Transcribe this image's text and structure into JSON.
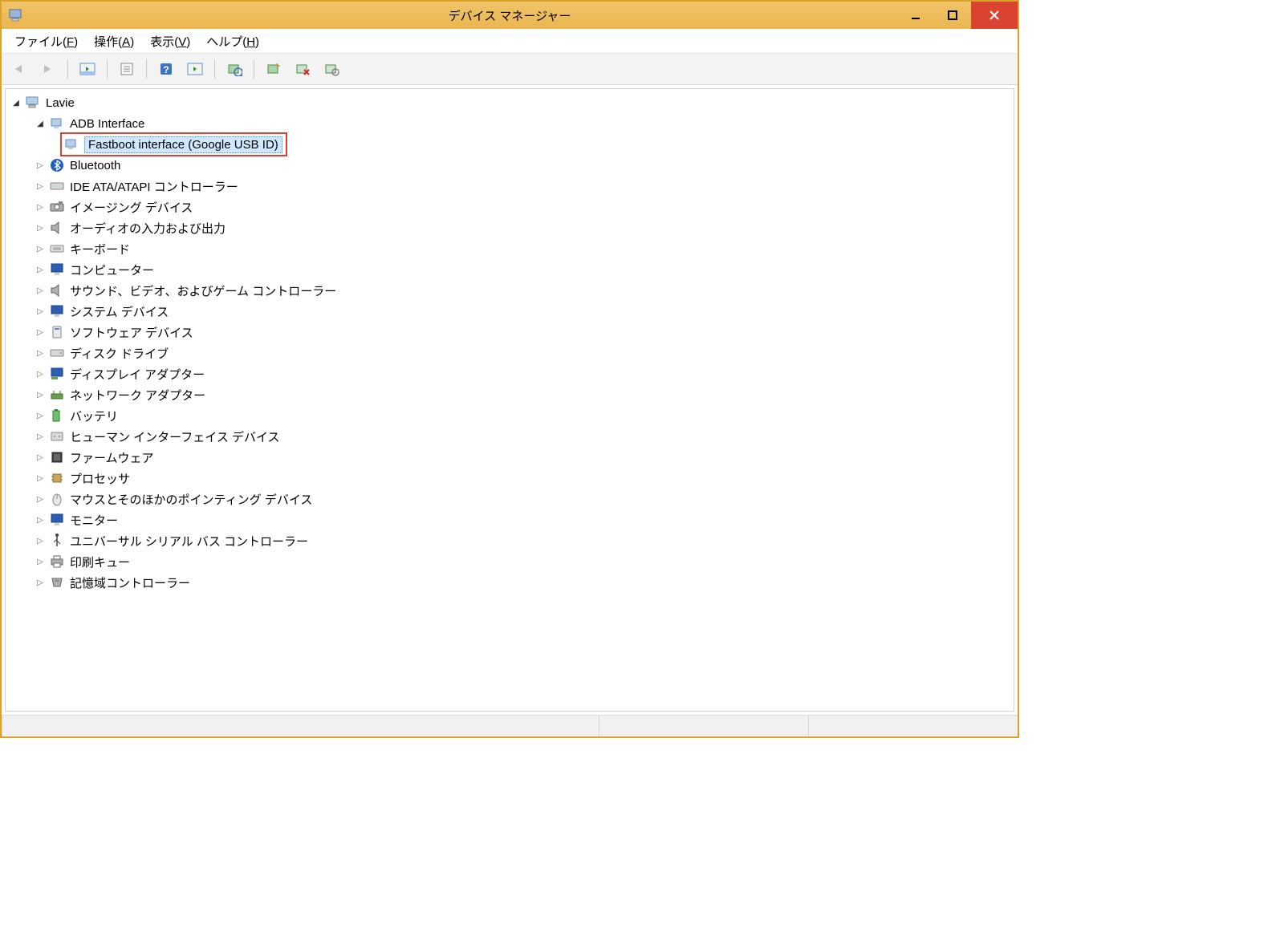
{
  "window": {
    "title": "デバイス マネージャー"
  },
  "menus": {
    "file": "ファイル(F)",
    "action": "操作(A)",
    "view": "表示(V)",
    "help": "ヘルプ(H)"
  },
  "tree": {
    "root": "Lavie",
    "adb_interface": "ADB Interface",
    "fastboot": "Fastboot interface (Google USB ID)",
    "bluetooth": "Bluetooth",
    "ide": "IDE ATA/ATAPI コントローラー",
    "imaging": "イメージング デバイス",
    "audio_io": "オーディオの入力および出力",
    "keyboard": "キーボード",
    "computer": "コンピューター",
    "sound_video_game": "サウンド、ビデオ、およびゲーム コントローラー",
    "system_devices": "システム デバイス",
    "software_devices": "ソフトウェア デバイス",
    "disk_drives": "ディスク ドライブ",
    "display_adapters": "ディスプレイ アダプター",
    "network_adapters": "ネットワーク アダプター",
    "battery": "バッテリ",
    "hid": "ヒューマン インターフェイス デバイス",
    "firmware": "ファームウェア",
    "processor": "プロセッサ",
    "mice": "マウスとそのほかのポインティング デバイス",
    "monitor": "モニター",
    "usb": "ユニバーサル シリアル バス コントローラー",
    "print_queues": "印刷キュー",
    "storage_controllers": "記憶域コントローラー"
  }
}
